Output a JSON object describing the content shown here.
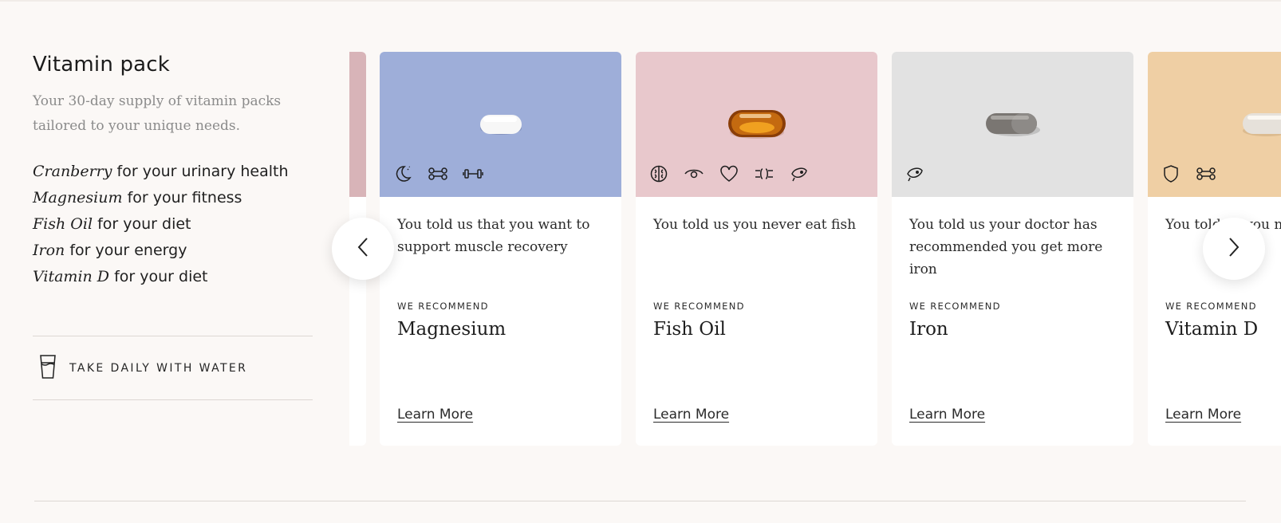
{
  "pack": {
    "title": "Vitamin pack",
    "subtitle": "Your 30-day supply of vitamin packs tailored to your unique needs.",
    "supplements": [
      {
        "name": "Cranberry",
        "purpose": "for your urinary health"
      },
      {
        "name": "Magnesium",
        "purpose": "for your fitness"
      },
      {
        "name": "Fish Oil",
        "purpose": "for your diet"
      },
      {
        "name": "Iron",
        "purpose": "for your energy"
      },
      {
        "name": "Vitamin D",
        "purpose": "for your diet"
      }
    ],
    "instruction": {
      "icon": "glass-of-water-icon",
      "label": "TAKE DAILY WITH WATER"
    }
  },
  "cards": [
    {
      "bg": "#9eaed9",
      "icons": [
        "moon-icon",
        "bone-icon",
        "dumbbell-icon"
      ],
      "reason": "You told us that you want to support muscle recovery",
      "rec_label": "WE RECOMMEND",
      "name": "Magnesium",
      "link": "Learn More"
    },
    {
      "bg": "#e8c8cc",
      "icons": [
        "brain-icon",
        "eye-icon",
        "heart-icon",
        "digestion-icon",
        "fish-icon"
      ],
      "reason": "You told us you never eat fish",
      "rec_label": "WE RECOMMEND",
      "name": "Fish Oil",
      "link": "Learn More"
    },
    {
      "bg": "#e2e2e2",
      "icons": [
        "fish-icon"
      ],
      "reason": "You told us your doctor has recommended you get more iron",
      "rec_label": "WE RECOMMEND",
      "name": "Iron",
      "link": "Learn More"
    },
    {
      "bg": "#efcfa4",
      "icons": [
        "shield-icon",
        "bone-icon"
      ],
      "reason": "You told us you n",
      "rec_label": "WE RECOMMEND",
      "name": "Vitamin D",
      "link": "Learn More"
    }
  ],
  "carousel": {
    "prev_icon": "chevron-left-icon",
    "next_icon": "chevron-right-icon"
  }
}
